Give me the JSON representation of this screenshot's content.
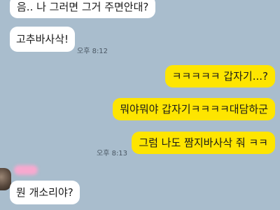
{
  "messages": [
    {
      "text": "음.. 나 그러면 그거 주면안대?"
    },
    {
      "text": "고추바사삭!"
    },
    {
      "text": "ㅋㅋㅋㅋㅋ 갑자기...?"
    },
    {
      "text": "뭐야뭐야 갑자기ㅋㅋㅋㅋ대담하군"
    },
    {
      "text": "그럼 나도 짬지바사삭 줘 ㅋㅋ"
    },
    {
      "text": "뭔 개소리야?"
    }
  ],
  "timestamps": [
    "오후 8:12",
    "오후 8:13"
  ],
  "colors": {
    "background": "#a9bdcd",
    "incoming_bubble": "#ffffff",
    "outgoing_bubble": "#fee500"
  }
}
